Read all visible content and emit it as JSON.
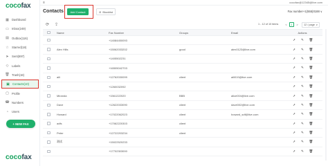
{
  "brand": {
    "logo_part1": "coco",
    "logo_part2": "fax"
  },
  "topbar": {
    "menu_icon": "hamburger-icon",
    "user": "cocofax@12345@live.com"
  },
  "sidebar": {
    "items": [
      {
        "label": "Dashboard",
        "icon": "dashboard-icon"
      },
      {
        "label": "Inbox(249)",
        "icon": "inbox-icon"
      },
      {
        "label": "Outbox(116)",
        "icon": "outbox-icon"
      },
      {
        "label": "Starred(18)",
        "icon": "star-icon"
      },
      {
        "label": "Sent(697)",
        "icon": "send-icon"
      },
      {
        "label": "Labels",
        "icon": "label-icon"
      },
      {
        "label": "Trash(18)",
        "icon": "trash-icon"
      },
      {
        "label": "Contacts(10)",
        "icon": "contacts-icon"
      },
      {
        "label": "Profile",
        "icon": "profile-icon"
      },
      {
        "label": "Numbers",
        "icon": "numbers-icon"
      },
      {
        "label": "Users",
        "icon": "users-icon"
      }
    ],
    "active_index": 7,
    "new_fax_label": "+ NEW FAX"
  },
  "header": {
    "title": "Contacts",
    "add_contact_label": "Add Contact",
    "blocklist_label": "Blocklist",
    "fax_number": "Fax number+1(555)0188 ∨"
  },
  "toolbar": {
    "pagination_info": "1 - 12 of 10 items",
    "prev": "<",
    "current_page": "1",
    "next": ">",
    "page_size": "12 / page",
    "page_size_chev": "∨"
  },
  "table": {
    "headers": {
      "name": "Name",
      "fax": "Fax Number",
      "groups": "Groups",
      "email": "Email",
      "actions": "Actions"
    },
    "rows": [
      {
        "name": "",
        "fax": "+14084450093",
        "groups": "",
        "email": ""
      },
      {
        "name": "Alex Hills",
        "fax": "+15062033202",
        "groups": "good",
        "email": "alex0123@live.com"
      },
      {
        "name": "",
        "fax": "+1405502231",
        "groups": "",
        "email": ""
      },
      {
        "name": "",
        "fax": "+16505042703",
        "groups": "",
        "email": ""
      },
      {
        "name": "aili",
        "fax": "+12762030099",
        "groups": "client",
        "email": "aili019@live.com"
      },
      {
        "name": "",
        "fax": "+1260032092",
        "groups": "",
        "email": ""
      },
      {
        "name": "Miranda",
        "fax": "+1561222020",
        "groups": "BBB",
        "email": "alice004@live.com"
      },
      {
        "name": "Dave",
        "fax": "+12622033090",
        "groups": "client",
        "email": "dave002@live.com"
      },
      {
        "name": "Howard",
        "fax": "+17022062023",
        "groups": "client",
        "email": "howard_sdf@live.com"
      },
      {
        "name": "adfs",
        "fax": "+17062220303",
        "groups": "client",
        "email": ""
      },
      {
        "name": "Peter",
        "fax": "+12722203234",
        "groups": "client",
        "email": ""
      },
      {
        "name": "测试",
        "fax": "+15022520233",
        "groups": "",
        "email": ""
      },
      {
        "name": "",
        "fax": "+17702303000",
        "groups": "",
        "email": ""
      }
    ]
  },
  "colors": {
    "accent": "#1fb06b",
    "highlight": "#d9342b"
  }
}
